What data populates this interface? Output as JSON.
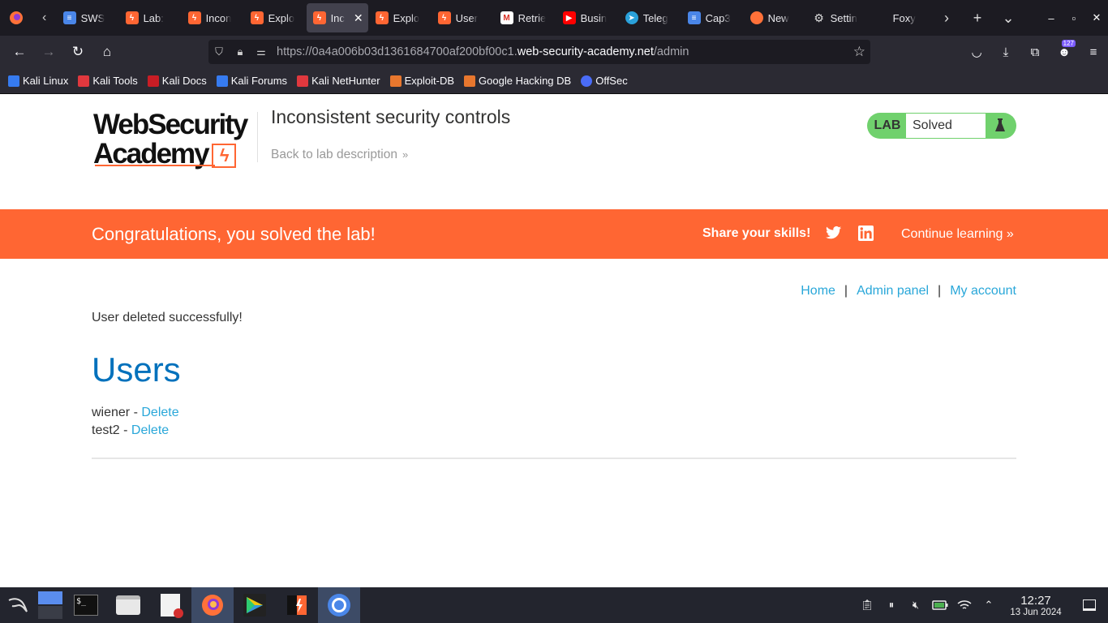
{
  "browser": {
    "tabs": [
      {
        "title": "SWS",
        "icon_color": "#4a86e8"
      },
      {
        "title": "Lab:",
        "icon_color": "#ff6633"
      },
      {
        "title": "Incon",
        "icon_color": "#ff6633"
      },
      {
        "title": "Explo",
        "icon_color": "#ff6633"
      },
      {
        "title": "Inc",
        "icon_color": "#ff6633",
        "active": true
      },
      {
        "title": "Explo",
        "icon_color": "#ff6633"
      },
      {
        "title": "User",
        "icon_color": "#ff6633"
      },
      {
        "title": "Retrie",
        "icon_color": "#d93025"
      },
      {
        "title": "Busin",
        "icon_color": "#ff0000"
      },
      {
        "title": "Teleg",
        "icon_color": "#2aa1da"
      },
      {
        "title": "Cap3",
        "icon_color": "#4a86e8"
      },
      {
        "title": "New",
        "icon_color": "#ff7139"
      },
      {
        "title": "Settin",
        "icon_color": "#888888"
      },
      {
        "title": "Foxy",
        "icon_color": "#1c1b22"
      }
    ],
    "url_prefix": "https://0a4a006b03d1361684700af200bf00c1.",
    "url_host": "web-security-academy.net",
    "url_path": "/admin",
    "extensions_badge": "127",
    "bookmarks": [
      {
        "label": "Kali Linux",
        "color": "#367bf0"
      },
      {
        "label": "Kali Tools",
        "color": "#e0383e"
      },
      {
        "label": "Kali Docs",
        "color": "#c81d25"
      },
      {
        "label": "Kali Forums",
        "color": "#367bf0"
      },
      {
        "label": "Kali NetHunter",
        "color": "#e0383e"
      },
      {
        "label": "Exploit-DB",
        "color": "#e8772e"
      },
      {
        "label": "Google Hacking DB",
        "color": "#e8772e"
      },
      {
        "label": "OffSec",
        "color": "#4a6cf7"
      }
    ]
  },
  "page": {
    "logo_line1": "WebSecurity",
    "logo_line2": "Academy",
    "lab_title": "Inconsistent security controls",
    "back_link": "Back to lab description",
    "lab_label": "LAB",
    "lab_state": "Solved",
    "banner": {
      "congrats": "Congratulations, you solved the lab!",
      "share": "Share your skills!",
      "continue": "Continue learning"
    },
    "nav": {
      "home": "Home",
      "admin": "Admin panel",
      "account": "My account",
      "separator": "|"
    },
    "message": "User deleted successfully!",
    "users_heading": "Users",
    "users": [
      {
        "name": "wiener",
        "sep": " - ",
        "action": "Delete"
      },
      {
        "name": "test2",
        "sep": " - ",
        "action": "Delete"
      }
    ]
  },
  "taskbar": {
    "time": "12:27",
    "date": "13 Jun 2024"
  },
  "colors": {
    "accent_orange": "#ff6633",
    "link_blue": "#29a7d9",
    "heading_blue": "#0071bc",
    "solved_green": "#70d16d"
  }
}
